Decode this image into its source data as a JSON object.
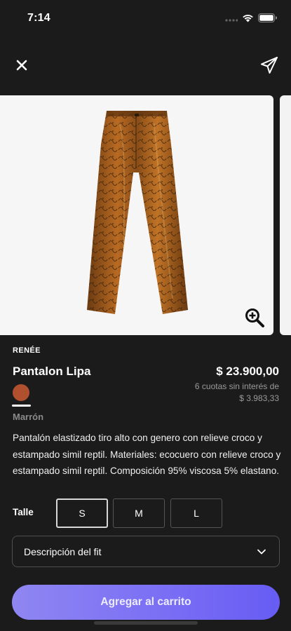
{
  "status_bar": {
    "time": "7:14"
  },
  "product": {
    "brand": "RENÉE",
    "name": "Pantalon Lipa",
    "price": "$ 23.900,00",
    "installments_line1": "6 cuotas sin interés de",
    "installments_line2": "$ 3.983,33",
    "color": {
      "name": "Marrón",
      "swatch": "#b1502e"
    },
    "description": "Pantalón elastizado tiro alto con genero con relieve croco y estampado simil reptil.  Materiales:  ecocuero con relieve croco y estampado simil reptil. Composición 95% viscosa 5% elastano.",
    "size_label": "Talle",
    "sizes": [
      "S",
      "M",
      "L"
    ],
    "selected_size": "S"
  },
  "fit_dropdown": {
    "label": "Descripción del fit"
  },
  "cart_button": {
    "label": "Agregar al carrito"
  },
  "colors": {
    "background": "#1b1b1b",
    "accent": "#7b6ff4"
  },
  "icons": {
    "close": "close-icon",
    "share": "send-icon",
    "zoom": "zoom-in-icon",
    "chevron": "chevron-down-icon"
  }
}
